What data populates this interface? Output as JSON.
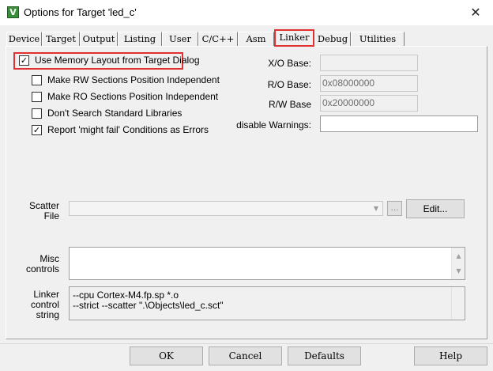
{
  "window": {
    "title": "Options for Target 'led_c'",
    "app_icon_letter": "V",
    "close_glyph": "✕"
  },
  "tabs": [
    {
      "label": "Device"
    },
    {
      "label": "Target"
    },
    {
      "label": "Output"
    },
    {
      "label": "Listing"
    },
    {
      "label": "User"
    },
    {
      "label": "C/C++"
    },
    {
      "label": "Asm"
    },
    {
      "label": "Linker",
      "active": true
    },
    {
      "label": "Debug"
    },
    {
      "label": "Utilities"
    }
  ],
  "linker": {
    "options": [
      {
        "label": "Use Memory Layout from Target Dialog",
        "checked": true
      },
      {
        "label": "Make RW Sections Position Independent",
        "checked": false
      },
      {
        "label": "Make RO Sections Position Independent",
        "checked": false
      },
      {
        "label": "Don't Search Standard Libraries",
        "checked": false
      },
      {
        "label": "Report 'might fail' Conditions as Errors",
        "checked": true
      }
    ],
    "check_glyph": "✓",
    "xo_base": {
      "label": "X/O Base:",
      "value": ""
    },
    "ro_base": {
      "label": "R/O Base:",
      "value": "0x08000000"
    },
    "rw_base": {
      "label": "R/W Base",
      "value": "0x20000000"
    },
    "disable_warnings": {
      "label": "disable Warnings:",
      "value": ""
    },
    "scatter": {
      "label_line1": "Scatter",
      "label_line2": "File",
      "value": "",
      "browse_label": "...",
      "edit_label": "Edit..."
    },
    "misc": {
      "label_line1": "Misc",
      "label_line2": "controls",
      "value": ""
    },
    "control_string": {
      "label_line1": "Linker",
      "label_line2": "control",
      "label_line3": "string",
      "lines": [
        "--cpu Cortex-M4.fp.sp *.o",
        "--strict --scatter \".\\Objects\\led_c.sct\""
      ]
    }
  },
  "footer": {
    "ok": "OK",
    "cancel": "Cancel",
    "defaults": "Defaults",
    "help": "Help"
  }
}
